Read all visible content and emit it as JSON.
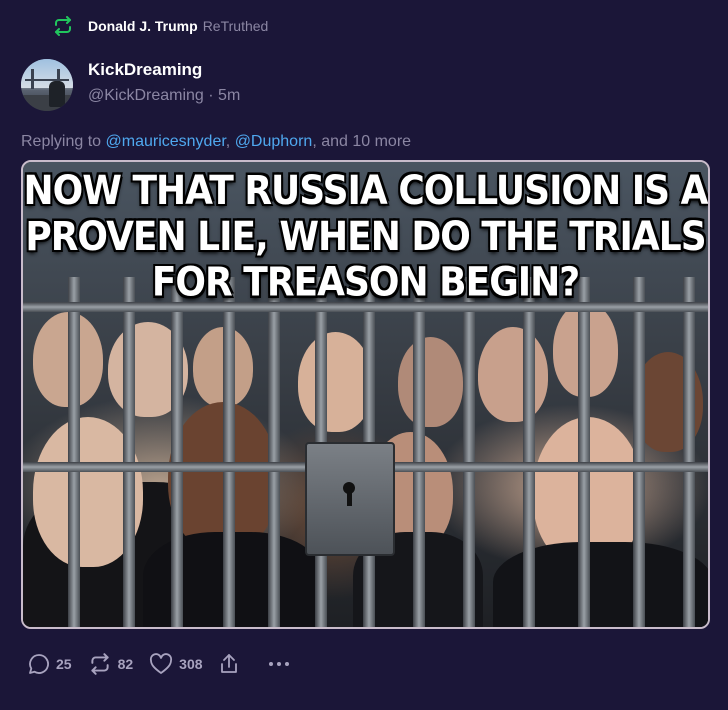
{
  "retruth": {
    "name": "Donald J. Trump",
    "label": "ReTruthed"
  },
  "author": {
    "display_name": "KickDreaming",
    "handle": "@KickDreaming",
    "separator": " · ",
    "time": "5m"
  },
  "reply": {
    "prefix": "Replying to ",
    "mentions": [
      "@mauricesnyder",
      "@Duphorn"
    ],
    "join": ", ",
    "suffix": ", and 10 more"
  },
  "media": {
    "headline_lines": [
      "NOW THAT RUSSIA COLLUSION IS A",
      "PROVEN LIE, WHEN DO THE TRIALS",
      "FOR TREASON BEGIN?"
    ]
  },
  "actions": {
    "replies": "25",
    "retruths": "82",
    "likes": "308"
  },
  "icons": {
    "retruth": "retruth-icon",
    "reply": "comment-icon",
    "repost": "retruth-icon",
    "like": "heart-icon",
    "share": "share-icon",
    "more": "more-icon"
  },
  "colors": {
    "background": "#1b1638",
    "accent_green": "#21c55d",
    "mention": "#4fa8ef",
    "muted": "#8b86a3"
  }
}
